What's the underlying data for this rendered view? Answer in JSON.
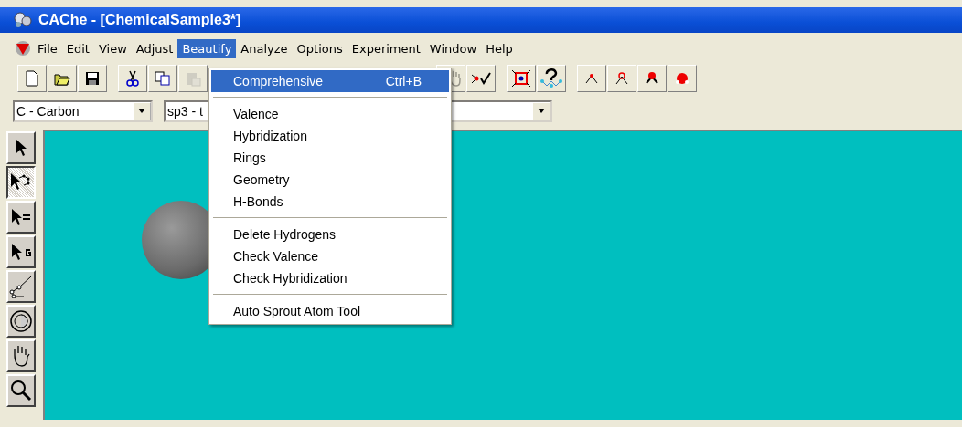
{
  "window": {
    "title": "CAChe - [ChemicalSample3*]"
  },
  "menu_bar": [
    {
      "label": "File",
      "selected": false
    },
    {
      "label": "Edit",
      "selected": false
    },
    {
      "label": "View",
      "selected": false
    },
    {
      "label": "Adjust",
      "selected": false
    },
    {
      "label": "Beautify",
      "selected": true
    },
    {
      "label": "Analyze",
      "selected": false
    },
    {
      "label": "Options",
      "selected": false
    },
    {
      "label": "Experiment",
      "selected": false
    },
    {
      "label": "Window",
      "selected": false
    },
    {
      "label": "Help",
      "selected": false
    }
  ],
  "toolbar": [
    {
      "kind": "new",
      "disabled": false
    },
    {
      "kind": "open",
      "disabled": false
    },
    {
      "kind": "save",
      "disabled": false
    },
    {
      "kind": "gap"
    },
    {
      "kind": "cut",
      "disabled": false
    },
    {
      "kind": "copy",
      "disabled": false
    },
    {
      "kind": "paste",
      "disabled": true
    },
    {
      "kind": "hidden"
    },
    {
      "kind": "hand",
      "disabled": true
    },
    {
      "kind": "check",
      "disabled": false
    },
    {
      "kind": "gap"
    },
    {
      "kind": "fit",
      "disabled": false
    },
    {
      "kind": "query",
      "disabled": false
    },
    {
      "kind": "gap"
    },
    {
      "kind": "atom1",
      "disabled": false
    },
    {
      "kind": "atom2",
      "disabled": false
    },
    {
      "kind": "atom3",
      "disabled": false
    },
    {
      "kind": "atom4",
      "disabled": false
    }
  ],
  "combos": [
    {
      "value": "C - Carbon"
    },
    {
      "value": "sp3 - t"
    }
  ],
  "tools": [
    {
      "kind": "select",
      "selected": false
    },
    {
      "kind": "select-group",
      "selected": true
    },
    {
      "kind": "select-bond",
      "selected": false
    },
    {
      "kind": "select-g",
      "selected": false
    },
    {
      "kind": "draw",
      "selected": false
    },
    {
      "kind": "rotate",
      "selected": false
    },
    {
      "kind": "hand",
      "selected": false
    },
    {
      "kind": "zoom",
      "selected": false
    }
  ],
  "beautify_menu": [
    {
      "kind": "item",
      "label": "Comprehensive",
      "shortcut": "Ctrl+B",
      "selected": true
    },
    {
      "kind": "separator"
    },
    {
      "kind": "item",
      "label": "Valence",
      "selected": false
    },
    {
      "kind": "item",
      "label": "Hybridization",
      "selected": false
    },
    {
      "kind": "item",
      "label": "Rings",
      "selected": false
    },
    {
      "kind": "item",
      "label": "Geometry",
      "selected": false
    },
    {
      "kind": "item",
      "label": "H-Bonds",
      "selected": false
    },
    {
      "kind": "separator"
    },
    {
      "kind": "item",
      "label": "Delete Hydrogens",
      "selected": false
    },
    {
      "kind": "item",
      "label": "Check Valence",
      "selected": false
    },
    {
      "kind": "item",
      "label": "Check Hybridization",
      "selected": false
    },
    {
      "kind": "separator"
    },
    {
      "kind": "item",
      "label": "Auto Sprout Atom Tool",
      "selected": false
    }
  ]
}
